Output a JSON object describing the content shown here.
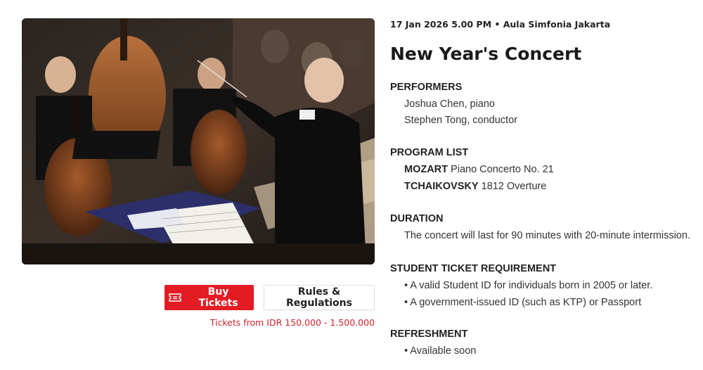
{
  "event": {
    "meta": "17 Jan 2026 5.00 PM • Aula Simfonia Jakarta",
    "title": "New Year's Concert"
  },
  "actions": {
    "buy_label": "Buy Tickets",
    "rules_label": "Rules & Regulations",
    "price_text": "Tickets from IDR 150.000 - 1.500.000"
  },
  "performers": {
    "heading": "PERFORMERS",
    "items": [
      "Joshua Chen, piano",
      "Stephen Tong, conductor"
    ]
  },
  "program": {
    "heading": "PROGRAM LIST",
    "items": [
      {
        "composer": "MOZART",
        "work": "Piano Concerto No. 21"
      },
      {
        "composer": "TCHAIKOVSKY",
        "work": "1812 Overture"
      }
    ]
  },
  "duration": {
    "heading": "DURATION",
    "text": "The concert will last for 90 minutes with 20-minute intermission."
  },
  "student": {
    "heading": "STUDENT TICKET REQUIREMENT",
    "items": [
      "• A valid Student ID for individuals born in 2005 or later.",
      "• A government-issued ID (such as KTP) or Passport"
    ]
  },
  "refreshment": {
    "heading": "REFRESHMENT",
    "items": [
      "• Available soon"
    ]
  },
  "colors": {
    "accent": "#e31b23",
    "price": "#d0202a"
  },
  "icons": {
    "buy": "ticket-icon"
  }
}
